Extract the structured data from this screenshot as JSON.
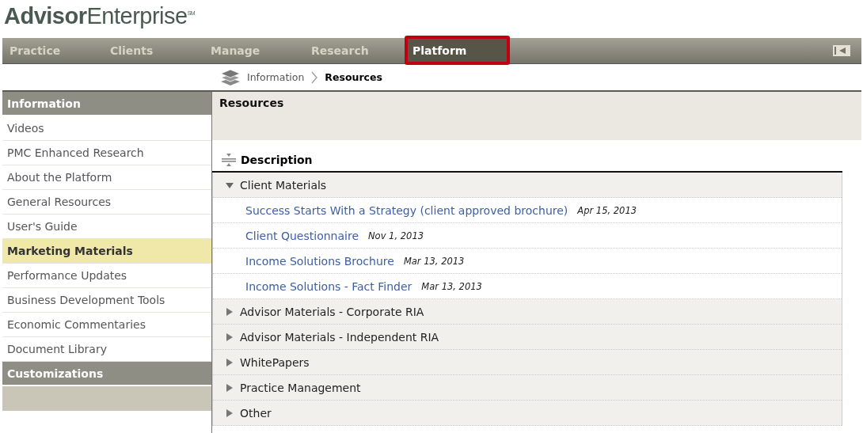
{
  "logo": "**Advisor**Enterprise$^{SM}$",
  "nav": [
    {
      "label": "Practice",
      "selected": false
    },
    {
      "label": "Clients",
      "selected": false
    },
    {
      "label": "Manage",
      "selected": false
    },
    {
      "label": "Research",
      "selected": false
    },
    {
      "label": "Platform",
      "selected": true
    }
  ],
  "breadcrumb": [
    {
      "label": "Information",
      "current": false
    },
    {
      "label": "Resources",
      "current": true
    }
  ],
  "sidebar": [
    {
      "kind": "header",
      "label": "Information"
    },
    {
      "kind": "item",
      "label": "Videos",
      "selected": false
    },
    {
      "kind": "item",
      "label": "PMC Enhanced Research",
      "selected": false
    },
    {
      "kind": "item",
      "label": "About the Platform",
      "selected": false
    },
    {
      "kind": "item",
      "label": "General Resources",
      "selected": false
    },
    {
      "kind": "item",
      "label": "User's Guide",
      "selected": false
    },
    {
      "kind": "item",
      "label": "Marketing Materials",
      "selected": true
    },
    {
      "kind": "item",
      "label": "Performance Updates",
      "selected": false
    },
    {
      "kind": "item",
      "label": "Business Development Tools",
      "selected": false
    },
    {
      "kind": "item",
      "label": "Economic Commentaries",
      "selected": false
    },
    {
      "kind": "item",
      "label": "Document Library",
      "selected": false
    },
    {
      "kind": "header",
      "label": "Customizations"
    },
    {
      "kind": "blank"
    }
  ],
  "page_title": "Resources",
  "table": {
    "column": "Description",
    "groups": [
      {
        "label": "Client Materials",
        "expanded": true,
        "children": [
          {
            "title": "Success Starts With a Strategy (client approved brochure)",
            "date": "Apr 15, 2013"
          },
          {
            "title": "Client Questionnaire",
            "date": "Nov 1, 2013"
          },
          {
            "title": "Income Solutions Brochure",
            "date": "Mar 13, 2013"
          },
          {
            "title": "Income Solutions - Fact Finder",
            "date": "Mar 13, 2013"
          }
        ]
      },
      {
        "label": "Advisor Materials - Corporate RIA",
        "expanded": false
      },
      {
        "label": "Advisor Materials - Independent RIA",
        "expanded": false
      },
      {
        "label": "WhitePapers",
        "expanded": false
      },
      {
        "label": "Practice Management",
        "expanded": false
      },
      {
        "label": "Other",
        "expanded": false
      }
    ]
  }
}
